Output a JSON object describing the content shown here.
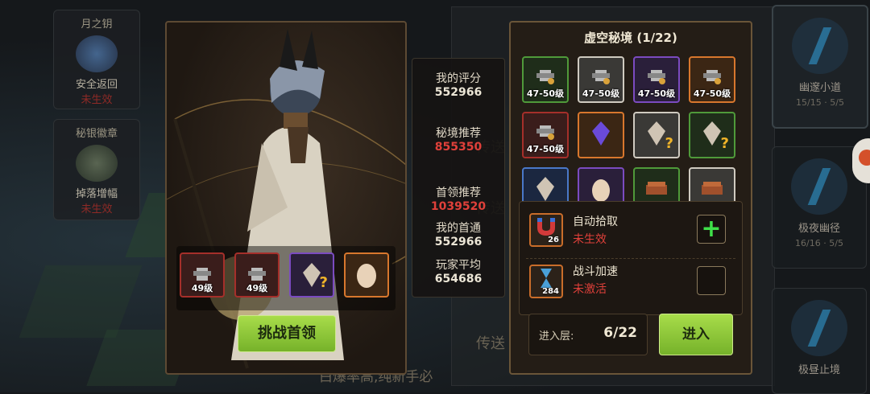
{
  "left_cards": [
    {
      "title": "月之钥",
      "name": "安全返回",
      "status": "未生效"
    },
    {
      "title": "秘银徽章",
      "name": "掉落增幅",
      "status": "未生效"
    }
  ],
  "right_cards": [
    {
      "name": "幽邃小道",
      "progress": "15/15",
      "keys": "5/5"
    },
    {
      "name": "极夜幽径",
      "progress": "16/16",
      "keys": "5/5"
    },
    {
      "name": "极昼止境"
    }
  ],
  "background_text": {
    "teleport": "传送",
    "footer": "白爆率高,纯新手必"
  },
  "boss_panel": {
    "loot": [
      {
        "rarity": "red",
        "icon": "armor-icon",
        "level": "49级"
      },
      {
        "rarity": "red",
        "icon": "armor-icon",
        "level": "49级"
      },
      {
        "rarity": "purple",
        "icon": "crystal-icon",
        "unknown": "?"
      },
      {
        "rarity": "orange",
        "icon": "egg-icon"
      }
    ],
    "challenge_button": "挑战首领"
  },
  "scores": {
    "my_rating_label": "我的评分",
    "my_rating": "552966",
    "realm_rec_label": "秘境推荐",
    "realm_rec": "855350",
    "boss_rec_label": "首领推荐",
    "boss_rec": "1039520",
    "my_first_label": "我的首通",
    "my_first": "552966",
    "avg_label": "玩家平均",
    "avg": "654686"
  },
  "dungeon": {
    "title": "虚空秘境 (1/22)",
    "rewards": [
      {
        "rarity": "green",
        "icon": "armor-icon",
        "level": "47-50级"
      },
      {
        "rarity": "white",
        "icon": "armor-icon",
        "level": "47-50级"
      },
      {
        "rarity": "purple",
        "icon": "armor-icon",
        "level": "47-50级"
      },
      {
        "rarity": "orange",
        "icon": "armor-icon",
        "level": "47-50级"
      },
      {
        "rarity": "red",
        "icon": "armor-icon",
        "level": "47-50级"
      },
      {
        "rarity": "orange",
        "icon": "crystal-icon"
      },
      {
        "rarity": "white",
        "icon": "crystal-icon",
        "unknown": "?"
      },
      {
        "rarity": "green",
        "icon": "crystal-icon",
        "unknown": "?"
      },
      {
        "rarity": "blue",
        "icon": "crystal-icon"
      },
      {
        "rarity": "purple",
        "icon": "egg-icon"
      },
      {
        "rarity": "green",
        "icon": "wood-icon"
      },
      {
        "rarity": "white",
        "icon": "wood-icon"
      }
    ],
    "auto_pickup": {
      "name": "自动拾取",
      "status": "未生效",
      "count": "26"
    },
    "battle_speed": {
      "name": "战斗加速",
      "status": "未激活",
      "count": "284"
    },
    "floor_label": "进入层:",
    "floor_value": "6/22",
    "enter_button": "进入"
  },
  "colors": {
    "accent_green": "#8cc63f",
    "status_red": "#e0403a",
    "panel_border": "#6a5538"
  }
}
